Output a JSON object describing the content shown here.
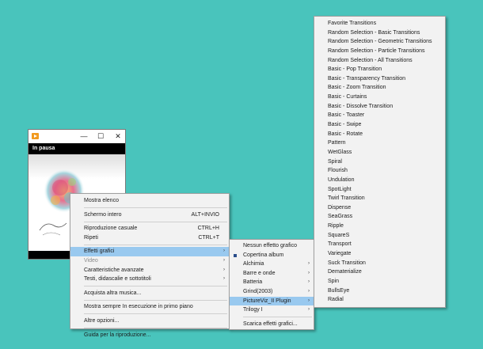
{
  "window": {
    "status": "In pausa",
    "controls": {
      "minimize": "—",
      "maximize": "☐",
      "close": "✕"
    }
  },
  "icons": {
    "app": "media-player-icon",
    "minimize": "minimize-icon",
    "maximize": "maximize-icon",
    "close": "close-icon",
    "album_art": "album-art-image"
  },
  "main_menu": [
    {
      "label": "Mostra elenco"
    },
    {
      "separator": true
    },
    {
      "label": "Schermo intero",
      "shortcut": "ALT+INVIO"
    },
    {
      "separator": true
    },
    {
      "label": "Riproduzione casuale",
      "shortcut": "CTRL+H"
    },
    {
      "label": "Ripeti",
      "shortcut": "CTRL+T"
    },
    {
      "separator": true
    },
    {
      "label": "Effetti grafici",
      "submenu": true,
      "highlighted": true
    },
    {
      "label": "Video",
      "submenu": true,
      "disabled": true
    },
    {
      "label": "Caratteristiche avanzate",
      "submenu": true
    },
    {
      "label": "Testi, didascalie e sottotitoli",
      "submenu": true
    },
    {
      "separator": true
    },
    {
      "label": "Acquista altra musica..."
    },
    {
      "separator": true
    },
    {
      "label": "Mostra sempre In esecuzione in primo piano"
    },
    {
      "separator": true
    },
    {
      "label": "Altre opzioni..."
    },
    {
      "separator": true
    },
    {
      "label": "Guida per la riproduzione..."
    }
  ],
  "effects_menu": [
    {
      "label": "Nessun effetto grafico"
    },
    {
      "label": "Copertina album",
      "checked": true
    },
    {
      "label": "Alchimia",
      "submenu": true
    },
    {
      "label": "Barre e onde",
      "submenu": true
    },
    {
      "label": "Batteria",
      "submenu": true
    },
    {
      "label": "Grind(2003)",
      "submenu": true
    },
    {
      "label": "PictureViz_II Plugin",
      "submenu": true,
      "highlighted": true
    },
    {
      "label": "Trilogy I",
      "submenu": true
    },
    {
      "separator": true
    },
    {
      "label": "Scarica effetti grafici..."
    }
  ],
  "transitions_menu": [
    "Favorite Transitions",
    "Random Selection - Basic Transitions",
    "Random Selection - Geometric Transitions",
    "Random Selection - Particle Transitions",
    "Random Selection - All Transitions",
    "Basic - Pop Transition",
    "Basic - Transparency Transition",
    "Basic - Zoom Transition",
    "Basic - Curtains",
    "Basic - Dissolve Transition",
    "Basic - Toaster",
    "Basic - Swipe",
    "Basic - Rotate",
    "Pattern",
    "WetGlass",
    "Spiral",
    "Flourish",
    "Undulation",
    "SpotLight",
    "Twirl Transition",
    "Dispense",
    "SeaGrass",
    "Ripple",
    "SquareS",
    "Transport",
    "Variegate",
    "Suck Transition",
    "Dematerialize",
    "Spin",
    "BullsEye",
    "Radial"
  ]
}
